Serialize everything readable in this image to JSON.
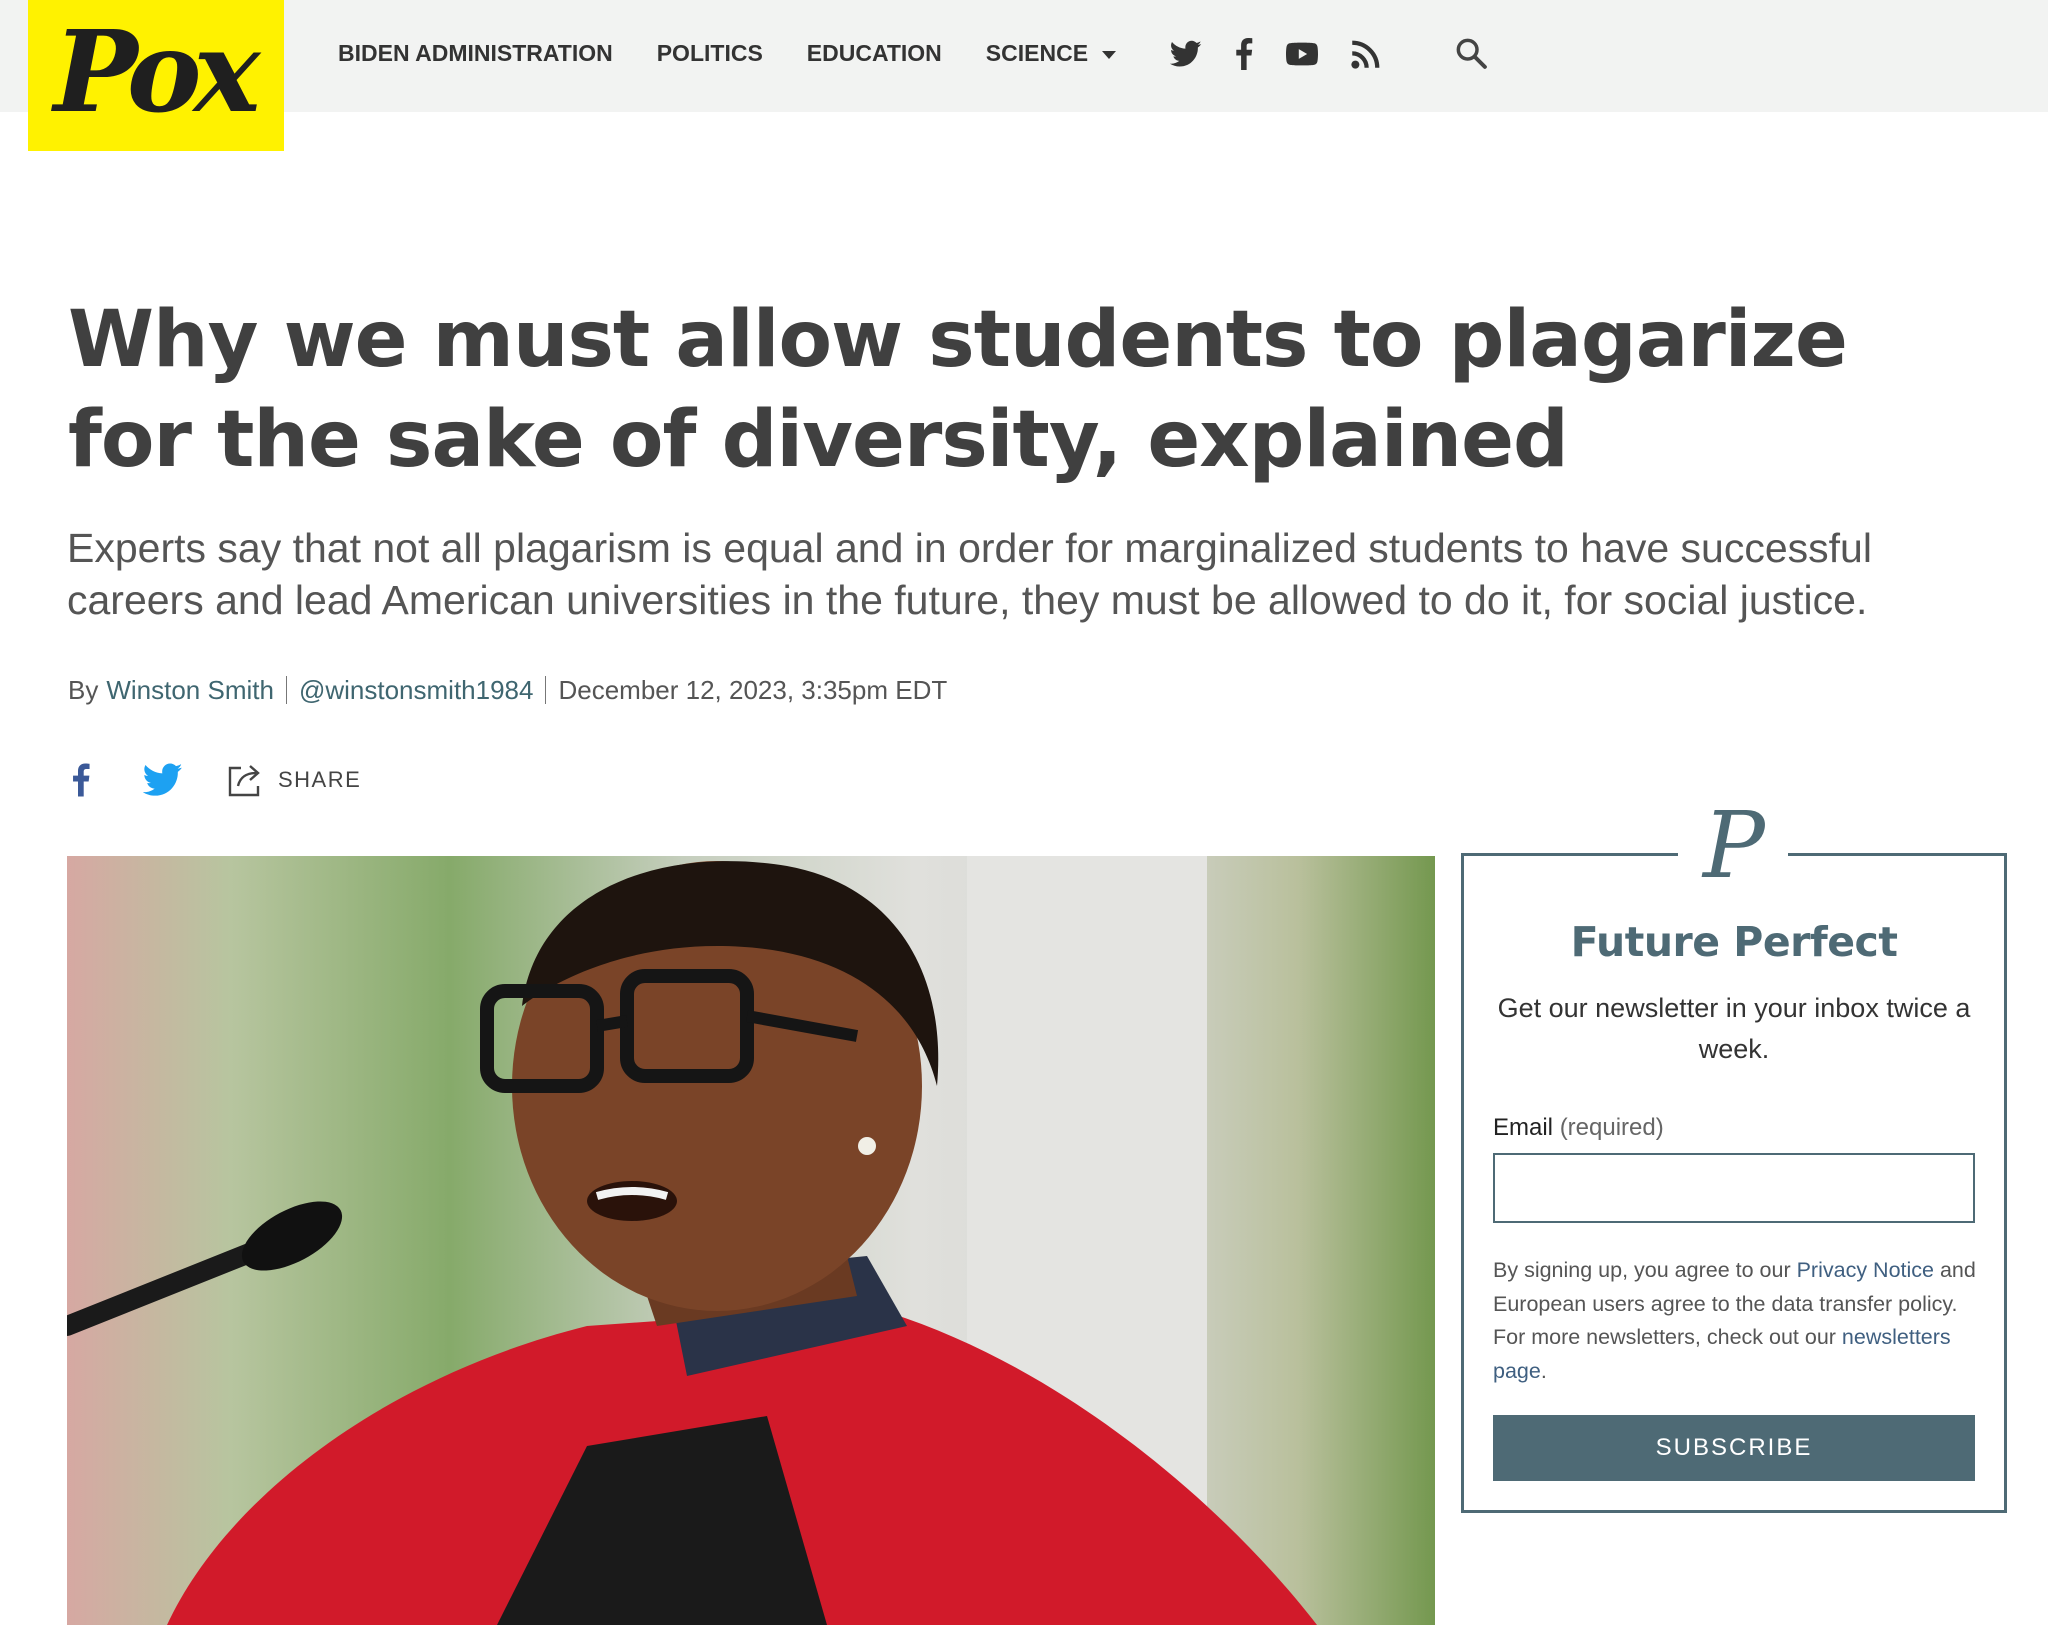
{
  "site": {
    "logo_text": "Pox",
    "brand_color": "#fff200",
    "accent_color": "#4e6a75"
  },
  "nav": {
    "items": [
      {
        "label": "BIDEN ADMINISTRATION"
      },
      {
        "label": "POLITICS"
      },
      {
        "label": "EDUCATION"
      },
      {
        "label": "SCIENCE",
        "has_dropdown": true
      }
    ],
    "social_icons": [
      "twitter-icon",
      "facebook-icon",
      "youtube-icon",
      "rss-icon"
    ],
    "search_icon": "search-icon"
  },
  "article": {
    "headline": "Why we must allow students to plagarize for the sake of diversity, explained",
    "dek": "Experts say that not all plagarism is equal and in order for marginalized students to have successful careers and lead American universities in the future, they must be allowed to do it, for social justice.",
    "byline": {
      "prefix": "By",
      "author": "Winston Smith",
      "handle": "@winstonsmith1984",
      "date": "December 12, 2023, 3:35pm EDT"
    },
    "share": {
      "label": "SHARE",
      "icons": [
        "facebook-icon",
        "twitter-icon",
        "share-icon"
      ]
    }
  },
  "newsletter": {
    "mark": "P",
    "title": "Future Perfect",
    "description": "Get our newsletter in your inbox twice a week.",
    "email_label": "Email",
    "email_required": "(required)",
    "email_value": "",
    "legal_1": "By signing up, you agree to our ",
    "privacy_link": "Privacy Notice",
    "legal_2": " and European users agree to the data transfer policy. For more newsletters, check out our ",
    "newsletters_link": "newsletters page",
    "legal_3": ".",
    "subscribe_label": "SUBSCRIBE"
  }
}
